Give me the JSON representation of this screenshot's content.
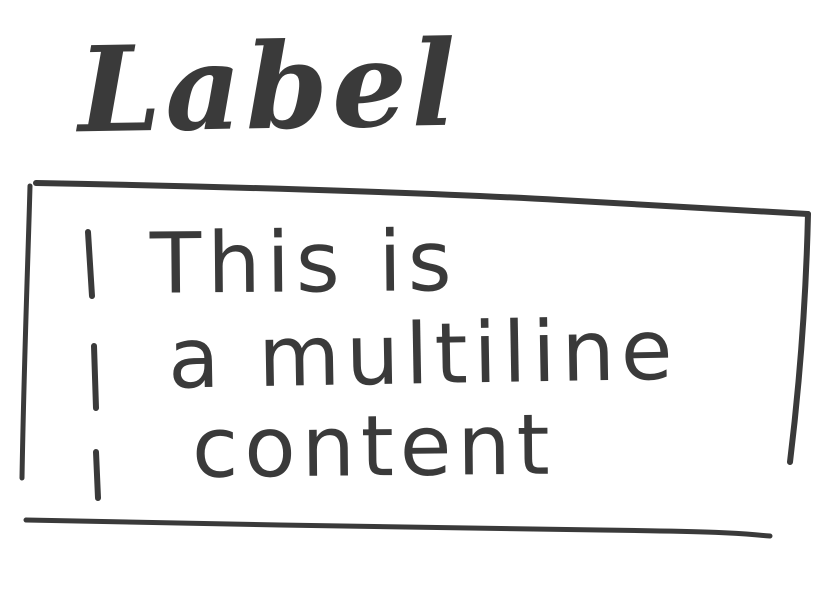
{
  "field": {
    "label": "Label",
    "content_lines": [
      "This is",
      "a multiline",
      "content"
    ]
  },
  "colors": {
    "ink": "#3a3a3a",
    "paper": "#ffffff"
  }
}
